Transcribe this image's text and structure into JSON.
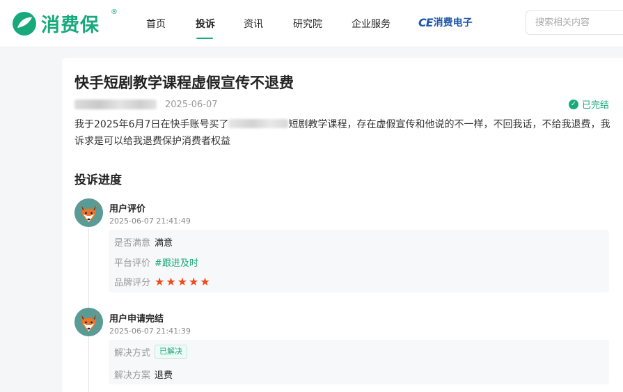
{
  "header": {
    "logo_text": "消费保",
    "logo_reg": "®",
    "nav": [
      {
        "label": "首页",
        "active": false
      },
      {
        "label": "投诉",
        "active": true
      },
      {
        "label": "资讯",
        "active": false
      },
      {
        "label": "研究院",
        "active": false
      },
      {
        "label": "企业服务",
        "active": false
      }
    ],
    "partner_mark": "CE",
    "partner_text": "消费电子",
    "search_placeholder": "搜索相关内容"
  },
  "complaint": {
    "title": "快手短剧教学课程虚假宣传不退费",
    "date": "2025-06-07",
    "status": "已完结",
    "status_icon": "check-circle-icon",
    "desc_before": "我于2025年6月7日在快手账号买了",
    "desc_after": "短剧教学课程，存在虚假宣传和他说的不一样，不回我话，不给我退费，我诉求是可以给我退费保护消费者权益"
  },
  "progress": {
    "title": "投诉进度",
    "events": [
      {
        "title": "用户评价",
        "time": "2025-06-07 21:41:49",
        "avatar": "fox-avatar",
        "rows": [
          {
            "label": "是否满意",
            "value": "满意"
          },
          {
            "label": "平台评价",
            "value": "#跟进及时"
          },
          {
            "label": "品牌评分",
            "value": 5
          }
        ]
      },
      {
        "title": "用户申请完结",
        "time": "2025-06-07 21:41:39",
        "avatar": "fox-avatar",
        "rows": [
          {
            "label": "解决方式",
            "value": "已解决"
          },
          {
            "label": "解决方案",
            "value": "退费"
          }
        ]
      }
    ]
  },
  "colors": {
    "brand": "#17a97a",
    "star": "#f04a1a",
    "partner": "#1e56a8"
  }
}
